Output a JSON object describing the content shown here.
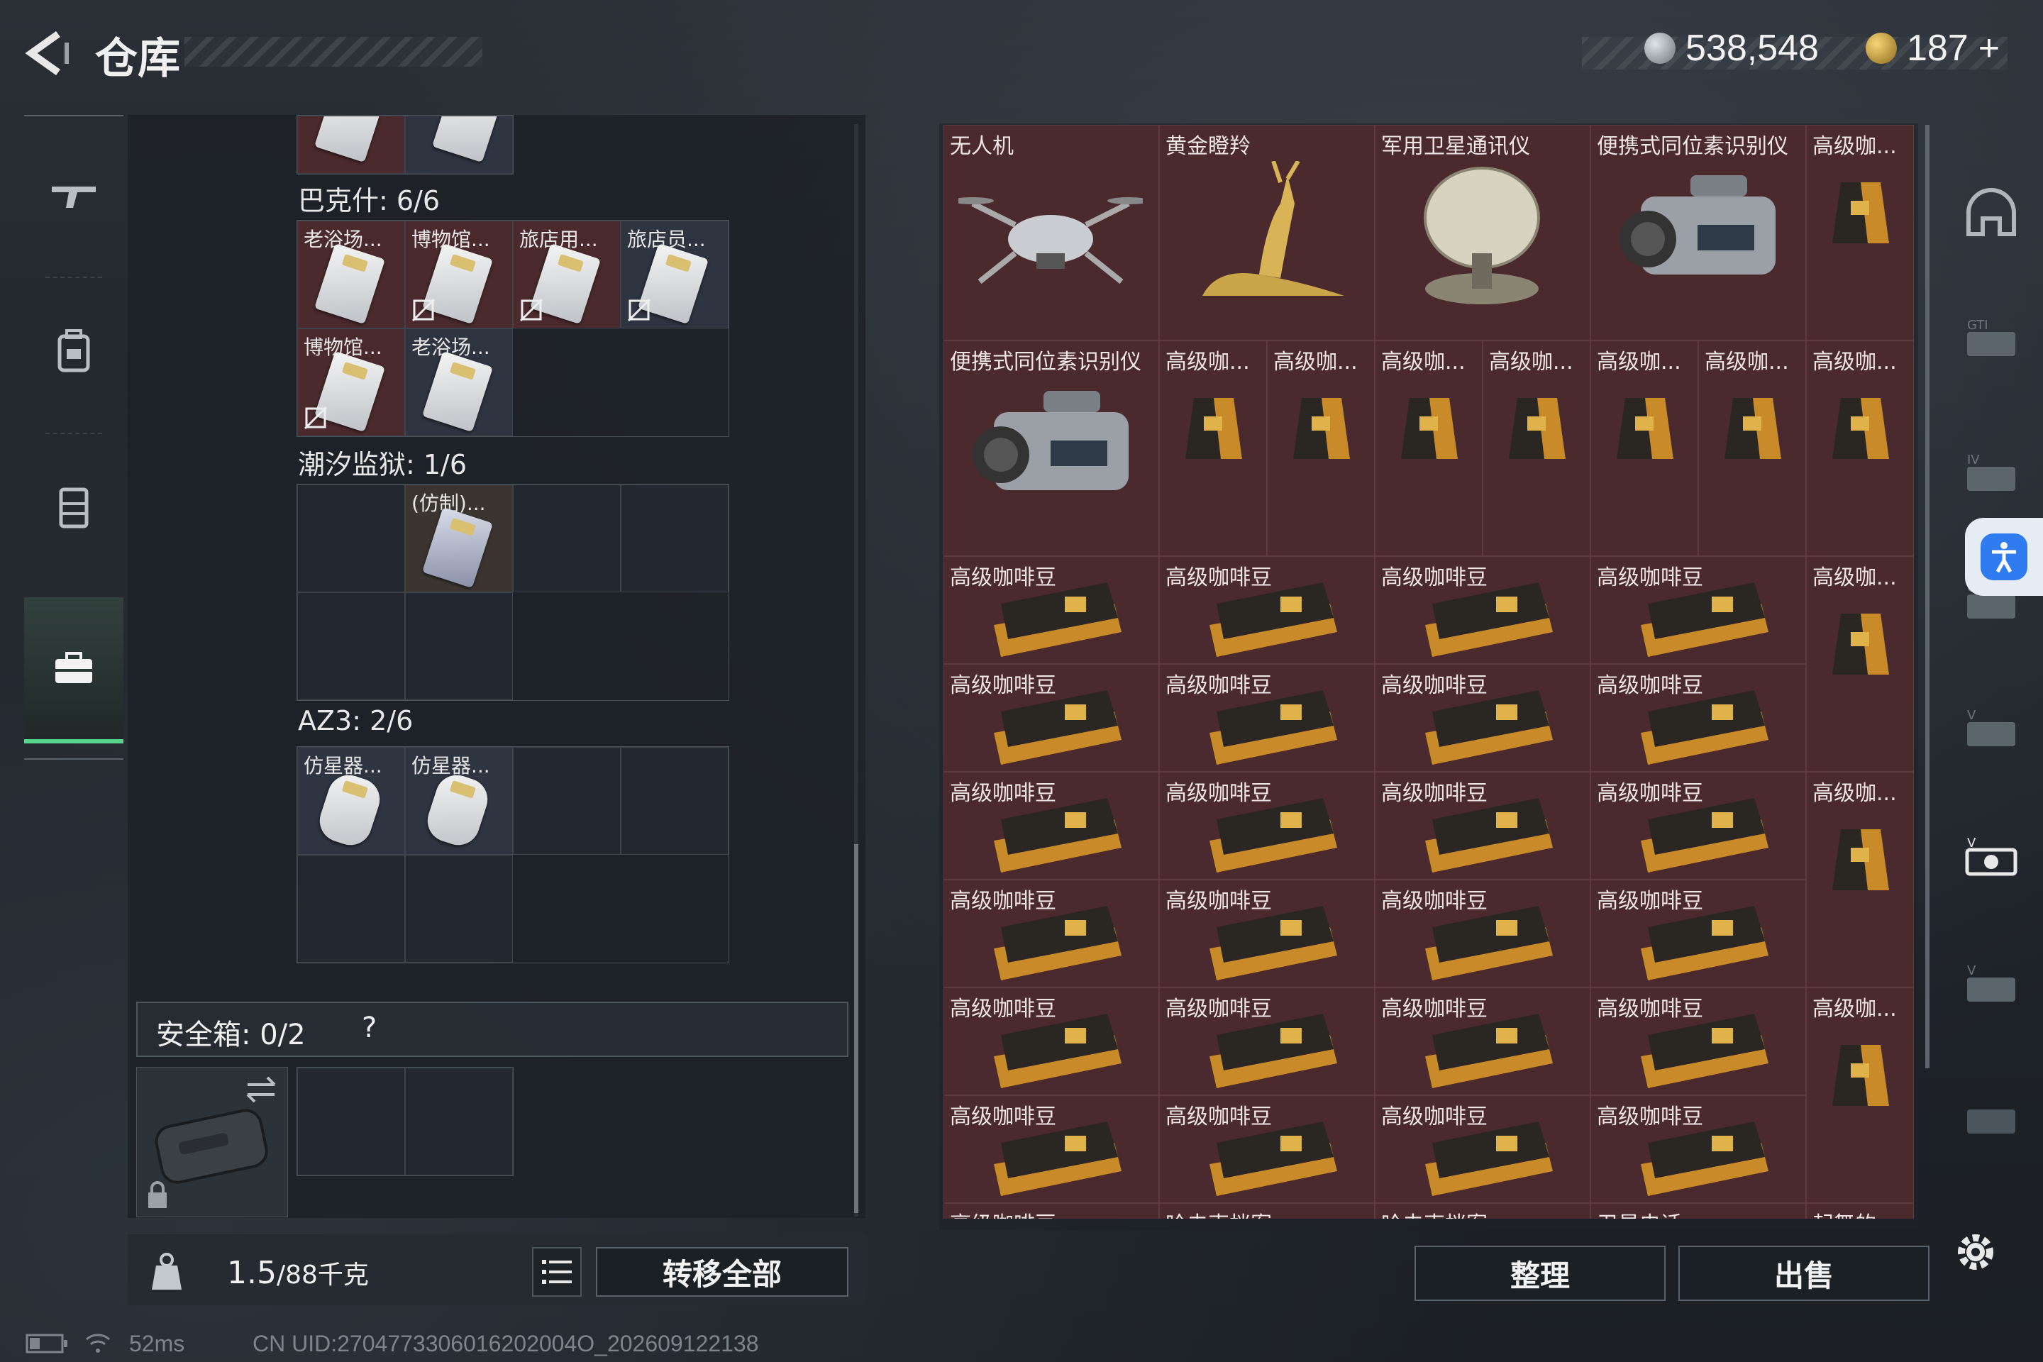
{
  "header": {
    "title": "仓库"
  },
  "currency": {
    "silver": "538,548",
    "gold": "187",
    "gold_plus": "+"
  },
  "left_nav": [
    {
      "icon": "rifle-icon",
      "active": false
    },
    {
      "icon": "backpack-icon",
      "active": false
    },
    {
      "icon": "vest-icon",
      "active": false
    },
    {
      "icon": "case-icon",
      "active": true
    }
  ],
  "groups": [
    {
      "title": "巴克什: 6/6",
      "items": [
        "老浴场...",
        "博物馆...",
        "旅店用...",
        "旅店员...",
        "博物馆...",
        "老浴场..."
      ]
    },
    {
      "title": "潮汐监狱: 1/6",
      "items": [
        "",
        "(仿制)..."
      ]
    },
    {
      "title": "AZ3: 2/6",
      "items": [
        "仿星器...",
        "仿星器..."
      ]
    }
  ],
  "safe_box": {
    "label": "安全箱: 0/2",
    "help": "?"
  },
  "footer_left": {
    "weight": "1.5",
    "weight_unit": "/88千克",
    "transfer_label": "转移全部"
  },
  "status": {
    "ping": "52ms",
    "uid": "CN UID:2704773306016202004O_202609122138"
  },
  "stash": {
    "row1": [
      "无人机",
      "黄金瞪羚",
      "军用卫星通讯仪",
      "便携式同位素识别仪",
      "高级咖..."
    ],
    "row2": [
      "便携式同位素识别仪",
      "高级咖...",
      "高级咖...",
      "高级咖...",
      "高级咖...",
      "高级咖...",
      "高级咖...",
      "高级咖..."
    ],
    "coffee_label": "高级咖啡豆",
    "coffee_short": "高级咖...",
    "bottom_row": [
      "高级咖啡豆",
      "哈夫克档案",
      "哈夫克档案",
      "卫星电话",
      "起舞的..."
    ]
  },
  "footer_right": {
    "organize_label": "整理",
    "sell_label": "出售"
  },
  "right_nav": [
    "helmet-icon",
    "gti-icon",
    "iv-plus-icon",
    "gti2-icon",
    "v-icon",
    "v-active-icon",
    "v3-icon",
    "plain-icon"
  ],
  "colors": {
    "item_red": "#4a2a2c",
    "active_green": "#57d38a",
    "access_blue": "#2f7bf0"
  }
}
